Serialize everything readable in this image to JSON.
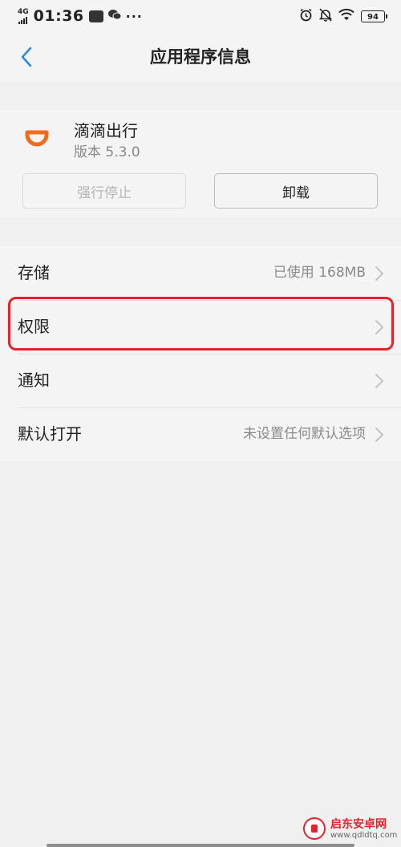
{
  "status_bar": {
    "network": "4G",
    "time": "01:36",
    "notification_icons": [
      "app-icon",
      "wechat-icon"
    ],
    "more": "···",
    "right_icons": [
      "alarm-icon",
      "mute-bell-icon",
      "wifi-icon"
    ],
    "battery": "94"
  },
  "header": {
    "title": "应用程序信息",
    "back_icon": "chevron-left-icon"
  },
  "app": {
    "name": "滴滴出行",
    "version": "版本 5.3.0",
    "icon_color": "#f26b1d",
    "force_stop_label": "强行停止",
    "uninstall_label": "卸载"
  },
  "list": {
    "items": [
      {
        "title": "存储",
        "value": "已使用 168MB"
      },
      {
        "title": "权限",
        "value": ""
      },
      {
        "title": "通知",
        "value": ""
      },
      {
        "title": "默认打开",
        "value": "未设置任何默认选项"
      }
    ]
  },
  "highlight_color": "#e2232c",
  "watermark": {
    "name": "启东安卓网",
    "url": "www.qdldtq.com"
  }
}
